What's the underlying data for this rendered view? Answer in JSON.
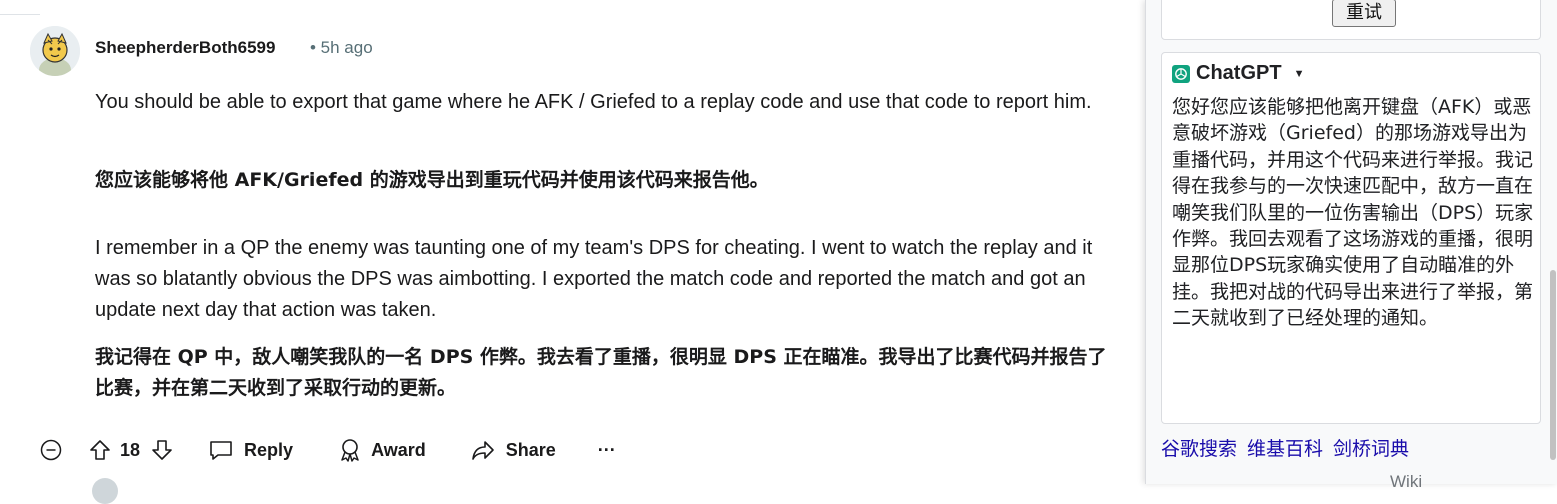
{
  "comment": {
    "username": "SheepherderBoth6599",
    "time": "• 5h ago",
    "paragraphs": [
      "You should be able to export that game where he AFK / Griefed to a replay code and use that code to report him.",
      "您应该能够将他 AFK/Griefed 的游戏导出到重玩代码并使用该代码来报告他。",
      "I remember in a QP the enemy was taunting one of my team's DPS for cheating. I went to watch the replay and it was so blatantly obvious the DPS was aimbotting. I exported the match code and reported the match and got an update next day that action was taken.",
      "我记得在 QP 中，敌人嘲笑我队的一名 DPS 作弊。我去看了重播，很明显 DPS 正在瞄准。我导出了比赛代码并报告了比赛，并在第二天收到了采取行动的更新。"
    ],
    "vote_count": "18",
    "reply_label": "Reply",
    "award_label": "Award",
    "share_label": "Share",
    "more_label": "···"
  },
  "panel": {
    "retry_label": "重试",
    "gpt_title": "ChatGPT",
    "gpt_answer": "您好您应该能够把他离开键盘（AFK）或恶意破坏游戏（Griefed）的那场游戏导出为重播代码，并用这个代码来进行举报。我记得在我参与的一次快速匹配中，敌方一直在嘲笑我们队里的一位伤害输出（DPS）玩家作弊。我回去观看了这场游戏的重播，很明显那位DPS玩家确实使用了自动瞄准的外挂。我把对战的代码导出来进行了举报，第二天就收到了已经处理的通知。",
    "links": [
      "谷歌搜索",
      "维基百科",
      "剑桥词典"
    ],
    "wiki_peek": "Wiki"
  },
  "colors": {
    "muted": "#576f76",
    "link": "#1a0dab",
    "gpt_green": "#10a37f"
  }
}
